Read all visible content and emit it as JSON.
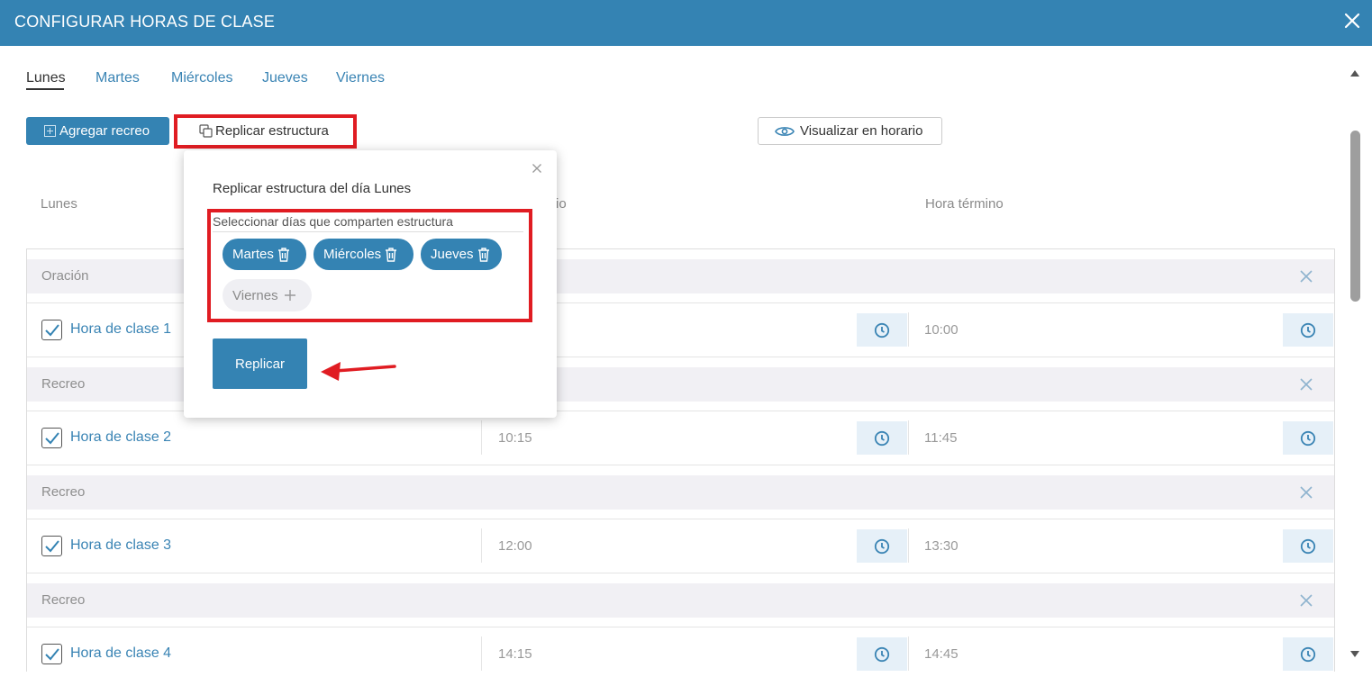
{
  "header": {
    "title": "CONFIGURAR HORAS DE CLASE"
  },
  "tabs": [
    {
      "label": "Lunes",
      "active": true
    },
    {
      "label": "Martes"
    },
    {
      "label": "Miércoles"
    },
    {
      "label": "Jueves"
    },
    {
      "label": "Viernes"
    }
  ],
  "toolbar": {
    "add_break_label": "Agregar recreo",
    "replicate_label": "Replicar estructura",
    "view_schedule_label": "Visualizar en horario"
  },
  "table": {
    "col_day": "Lunes",
    "col_start_partial": "io",
    "col_end": "Hora término",
    "rows": [
      {
        "type": "break",
        "label": "Oración"
      },
      {
        "type": "class",
        "label": "Hora de clase 1",
        "start": "",
        "end": "10:00"
      },
      {
        "type": "break",
        "label": "Recreo"
      },
      {
        "type": "class",
        "label": "Hora de clase 2",
        "start": "10:15",
        "end": "11:45"
      },
      {
        "type": "break",
        "label": "Recreo"
      },
      {
        "type": "class",
        "label": "Hora de clase 3",
        "start": "12:00",
        "end": "13:30"
      },
      {
        "type": "break",
        "label": "Recreo"
      },
      {
        "type": "class",
        "label": "Hora de clase 4",
        "start": "14:15",
        "end": "14:45"
      }
    ]
  },
  "popover": {
    "title": "Replicar estructura del día Lunes",
    "select_label": "Seleccionar días que comparten estructura",
    "selected_days": [
      "Martes",
      "Miércoles",
      "Jueves"
    ],
    "available_days": [
      "Viernes"
    ],
    "submit_label": "Replicar"
  },
  "colors": {
    "primary": "#3483b3",
    "highlight": "#e01c22"
  }
}
